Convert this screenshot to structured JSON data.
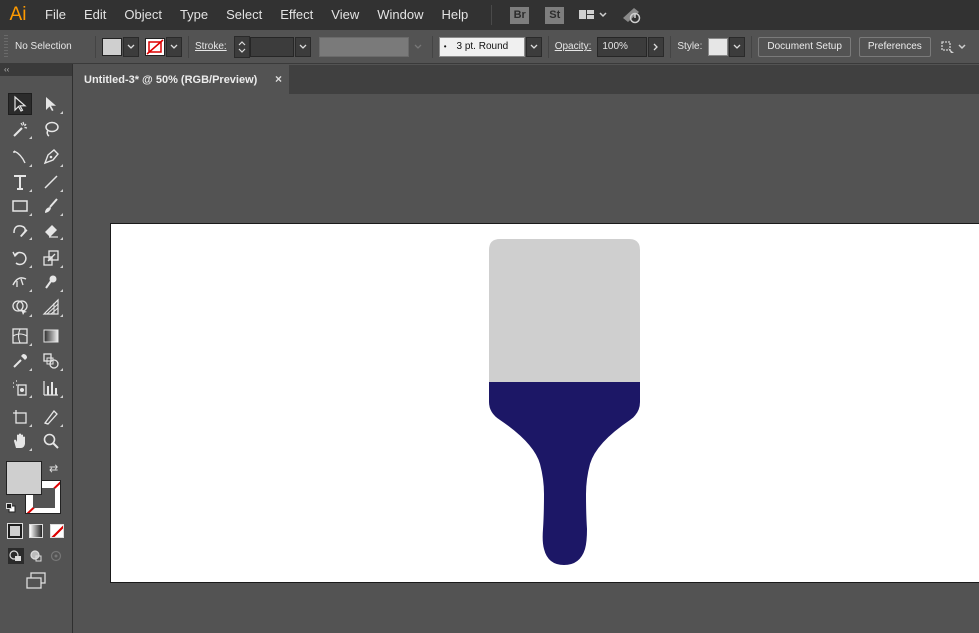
{
  "app": {
    "logo": "Ai"
  },
  "menu": {
    "items": [
      "File",
      "Edit",
      "Object",
      "Type",
      "Select",
      "Effect",
      "View",
      "Window",
      "Help"
    ],
    "bridge_badge": "Br",
    "stock_badge": "St",
    "icons": [
      "workspace-layout-icon",
      "gpu-performance-icon"
    ]
  },
  "control": {
    "selection_status": "No Selection",
    "fill_color": "#cfcfcf",
    "stroke_label": "Stroke:",
    "stroke_weight": "",
    "brush": "3 pt. Round",
    "opacity_label": "Opacity:",
    "opacity_value": "100%",
    "style_label": "Style:",
    "document_setup": "Document Setup",
    "preferences": "Preferences"
  },
  "document": {
    "tab_title": "Untitled-3* @ 50% (RGB/Preview)",
    "close_glyph": "×"
  },
  "toolbar": {
    "collapse_glyph": "‹‹",
    "fill_swatch": "#cfcfcf",
    "stroke_swatch": "none"
  },
  "artwork": {
    "bristles_color": "#cfcfcf",
    "handle_color": "#1c1766"
  }
}
